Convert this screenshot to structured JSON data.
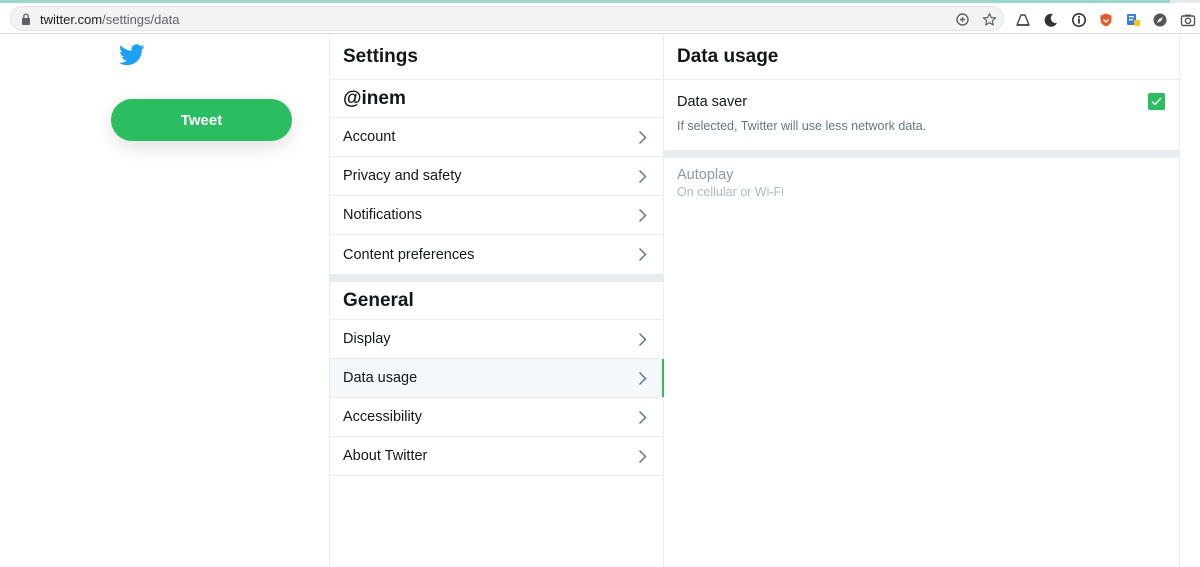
{
  "browser": {
    "url_host": "twitter.com",
    "url_path": "/settings/data",
    "icons": [
      "lock-icon",
      "zoom-icon",
      "star-icon",
      "cast-icon",
      "moon-icon",
      "info-icon",
      "shield-extension-icon",
      "puzzle-extension-icon",
      "compass-icon",
      "camera-icon"
    ]
  },
  "left": {
    "logo": "twitter-bird-icon",
    "tweet_button": "Tweet",
    "accent_color": "#2bbd62"
  },
  "settings": {
    "title": "Settings",
    "account_section": {
      "header": "@inem",
      "items": [
        {
          "label": "Account"
        },
        {
          "label": "Privacy and safety"
        },
        {
          "label": "Notifications"
        },
        {
          "label": "Content preferences"
        }
      ]
    },
    "general_section": {
      "header": "General",
      "items": [
        {
          "label": "Display"
        },
        {
          "label": "Data usage",
          "active": true
        },
        {
          "label": "Accessibility"
        },
        {
          "label": "About Twitter"
        }
      ]
    }
  },
  "data_usage": {
    "title": "Data usage",
    "data_saver": {
      "label": "Data saver",
      "description": "If selected, Twitter will use less network data.",
      "checked": true
    },
    "autoplay": {
      "label": "Autoplay",
      "value": "On cellular or Wi-Fi",
      "disabled": true
    }
  }
}
